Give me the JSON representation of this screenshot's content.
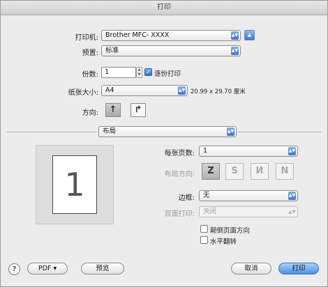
{
  "window": {
    "title": "打印"
  },
  "printer": {
    "label": "打印机:",
    "value": "Brother MFC- XXXX",
    "expand_glyph": "▲"
  },
  "preset": {
    "label": "预置:",
    "value": "标准"
  },
  "copies": {
    "label": "份数:",
    "value": "1",
    "collate_label": "逐份打印",
    "collate_checked": true
  },
  "paper_size": {
    "label": "纸张大小:",
    "value": "A4",
    "dimensions": "20.99 x 29.70 厘米"
  },
  "orientation": {
    "label": "方向:",
    "portrait_glyph": "↑",
    "landscape_glyph": "↱"
  },
  "panel": {
    "value": "布局"
  },
  "preview": {
    "page_number": "1"
  },
  "layout": {
    "pages_per_sheet_label": "每张页数:",
    "pages_per_sheet_value": "1",
    "direction_label": "布局方向:",
    "direction_glyphs": [
      "Z",
      "S",
      "И",
      "N"
    ],
    "border_label": "边框:",
    "border_value": "无",
    "duplex_label": "双面打印:",
    "duplex_value": "关闭",
    "reverse_orientation_label": "颠倒页面方向",
    "flip_horizontal_label": "水平翻转"
  },
  "footer": {
    "help_glyph": "?",
    "pdf_label": "PDF ▾",
    "preview_label": "预览",
    "cancel_label": "取消",
    "print_label": "打印"
  },
  "colors": {
    "accent": "#3d77d1",
    "window_bg": "#ececec"
  }
}
